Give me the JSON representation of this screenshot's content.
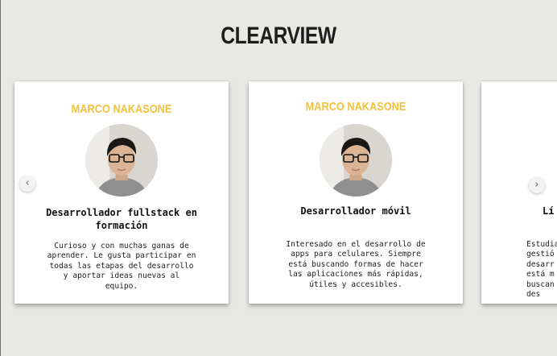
{
  "header": {
    "title": "CLEARVIEW"
  },
  "cards": [
    {
      "name": "MARCO NAKASONE",
      "role": "Desarrollador fullstack en formación",
      "description": "Curioso y con muchas ganas de aprender. Le gusta participar en todas las etapas del desarrollo y aportar ideas nuevas al equipo."
    },
    {
      "name": "MARCO NAKASONE",
      "role": "Desarrollador móvil",
      "description": "Interesado en el desarrollo de apps para celulares. Siempre está buscando formas de hacer las aplicaciones más rápidas, útiles y accesibles."
    },
    {
      "name": "",
      "role": "Lí",
      "description": "Estudia\ngestió\ndesarr\nestá m\nbuscan\ndes"
    }
  ],
  "carousel": {
    "prev_icon": "chevron-left-icon",
    "next_icon": "chevron-right-icon",
    "prev_glyph": "‹",
    "next_glyph": "›"
  },
  "colors": {
    "accent": "#f2c13c",
    "background": "#e8e8e4",
    "card": "#ffffff"
  }
}
